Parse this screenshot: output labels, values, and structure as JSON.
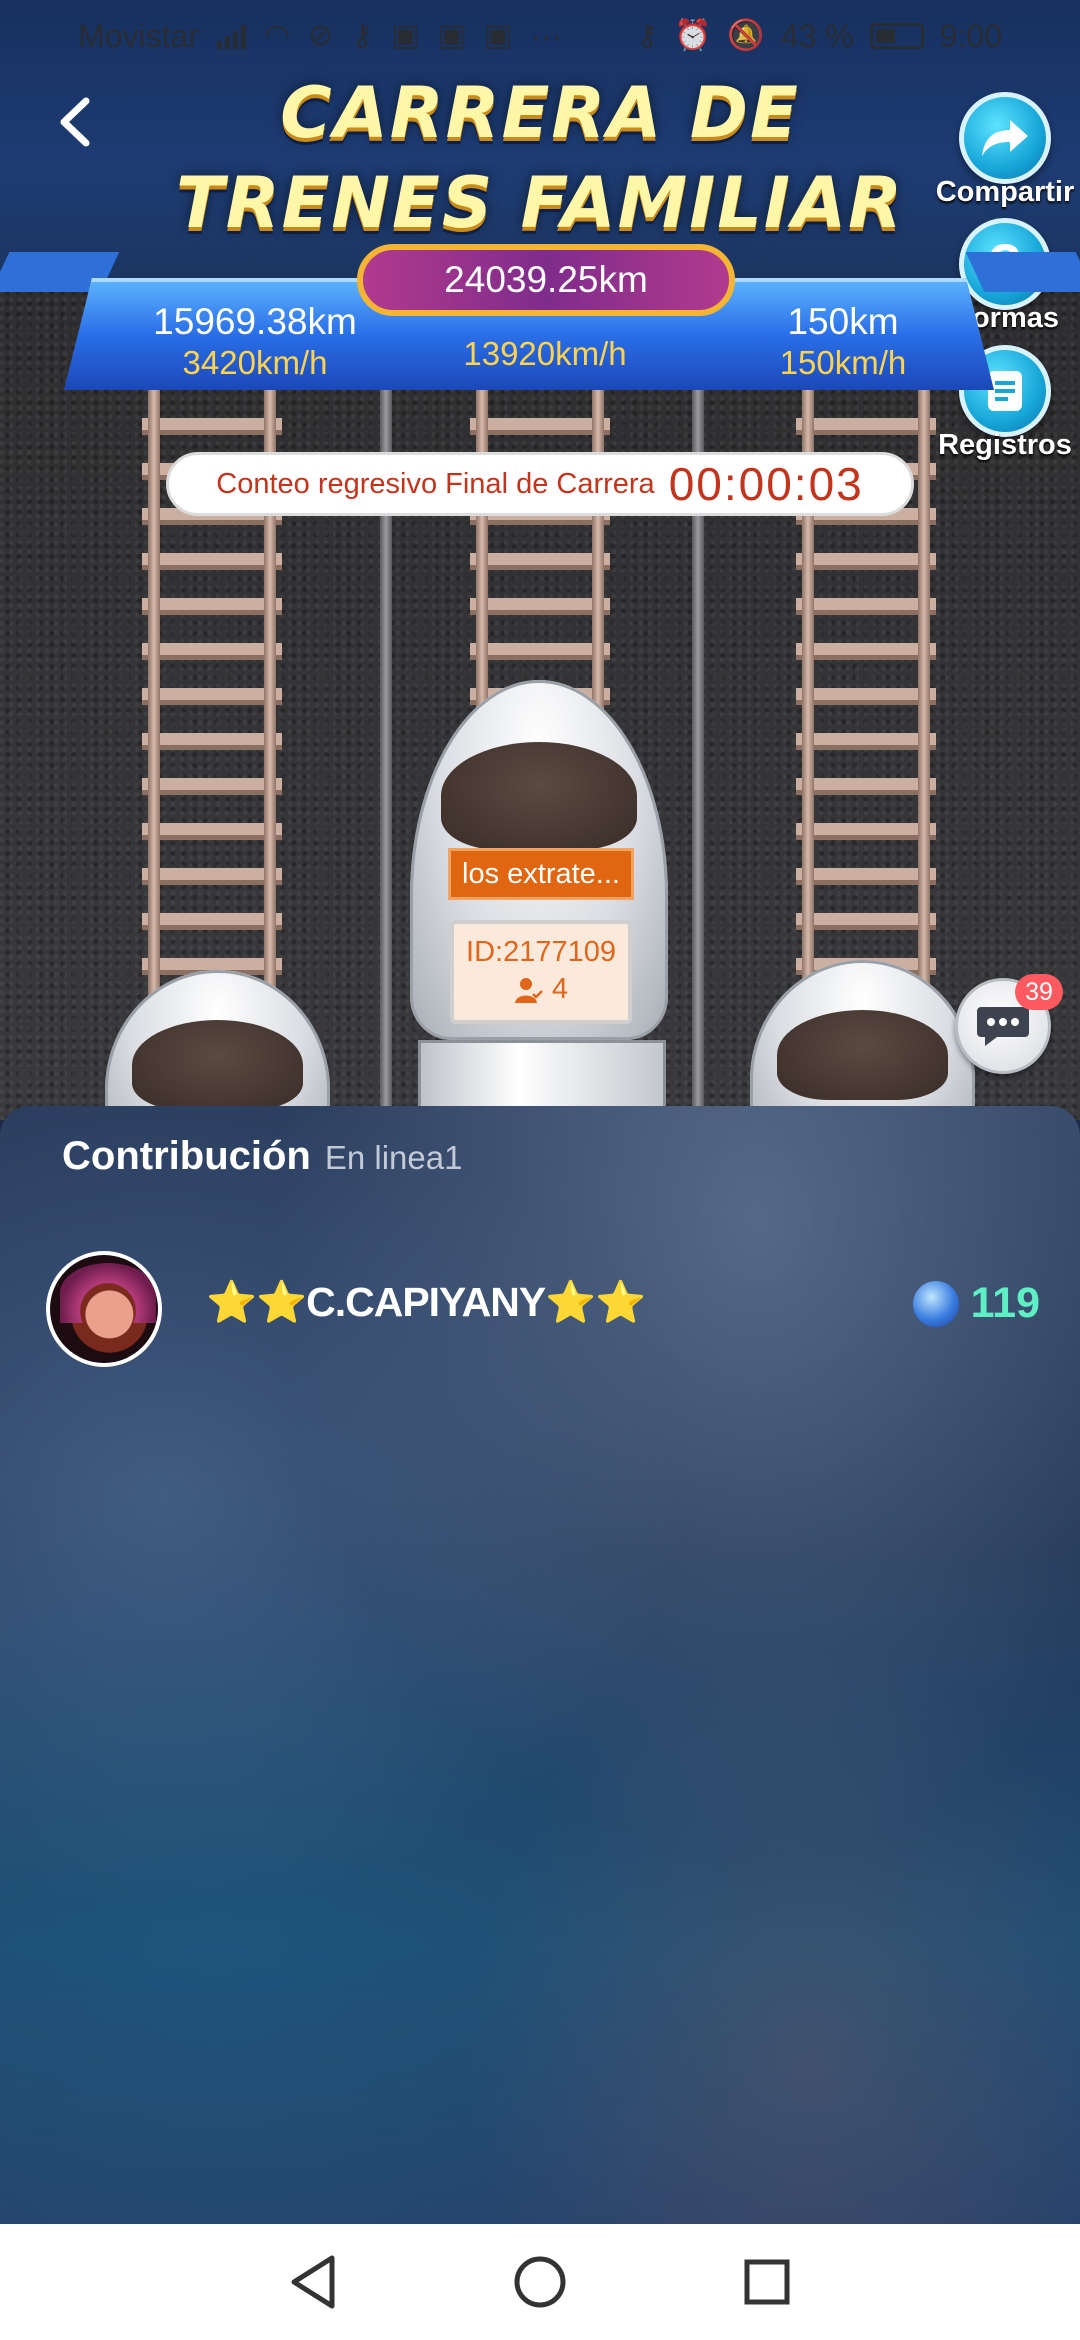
{
  "status_bar": {
    "carrier": "Movistar",
    "more": "···",
    "battery": "43 %",
    "time": "9:00"
  },
  "header": {
    "title_line1": "CARRERA DE",
    "title_line2": "TRENES FAMILIAR"
  },
  "side_buttons": {
    "share": "Compartir",
    "rules": "Normas",
    "records": "Registros"
  },
  "race": {
    "total_distance": "24039.25km",
    "lanes": [
      {
        "distance": "15969.38km",
        "speed": "3420km/h"
      },
      {
        "distance": "",
        "speed": "13920km/h"
      },
      {
        "distance": "150km",
        "speed": "150km/h"
      }
    ],
    "countdown_label": "Conteo regresivo Final de Carrera",
    "countdown_time": "00:00:03",
    "team_name": "los extrate...",
    "team_id": "ID:2177109",
    "team_members": "4"
  },
  "chat": {
    "badge": "39"
  },
  "contribution": {
    "title": "Contribución",
    "online": "En linea1",
    "rows": [
      {
        "name": "⭐⭐C.CAPIYANY⭐⭐",
        "score": "119"
      }
    ]
  },
  "colors": {
    "accent_blue": "#2a6fe8",
    "title_yellow": "#fff7a8",
    "countdown_red": "#c4341c",
    "score_green": "#5ef0c4"
  }
}
